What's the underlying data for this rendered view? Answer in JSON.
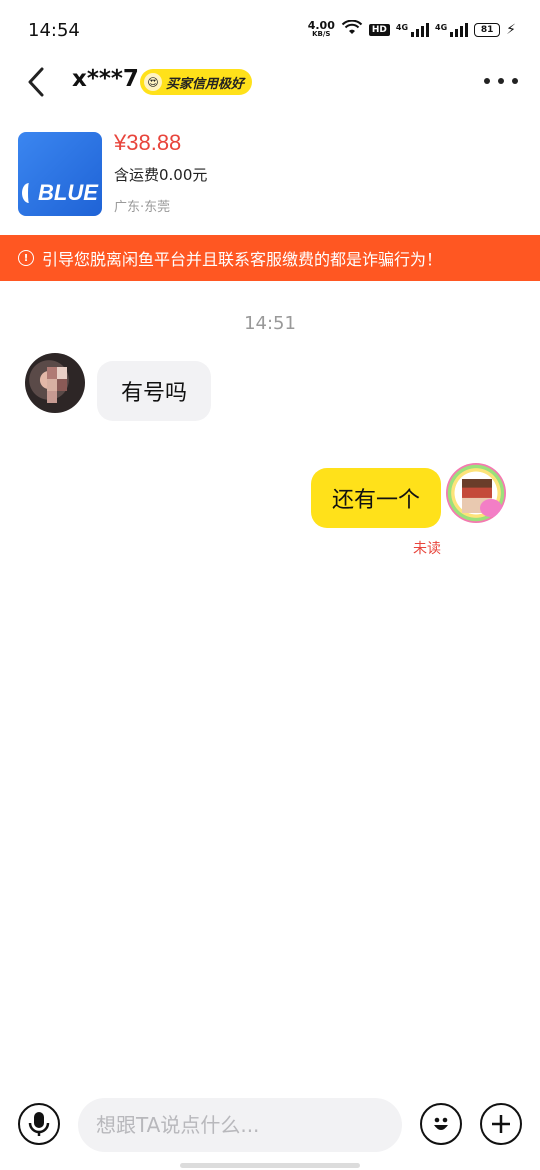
{
  "status_bar": {
    "time": "14:54",
    "net_speed": "4.00",
    "net_unit": "KB/S",
    "hd": "HD",
    "sim1": "4G",
    "sim2": "4G",
    "battery": "81"
  },
  "header": {
    "peer_name": "x***7",
    "credit_badge": "买家信用极好"
  },
  "product": {
    "image_text": "BLUE",
    "price": "¥38.88",
    "shipping": "含运费0.00元",
    "location": "广东·东莞"
  },
  "warning": {
    "text": "引导您脱离闲鱼平台并且联系客服缴费的都是诈骗行为！",
    "icon": "!"
  },
  "chat": {
    "timestamp": "14:51",
    "messages": [
      {
        "from": "peer",
        "text": "有号吗"
      },
      {
        "from": "me",
        "text": "还有一个",
        "status": "未读"
      }
    ]
  },
  "input": {
    "placeholder": "想跟TA说点什么..."
  },
  "colors": {
    "accent_yellow": "#ffe11a",
    "warning_orange": "#ff5722",
    "price_red": "#e8453c"
  }
}
